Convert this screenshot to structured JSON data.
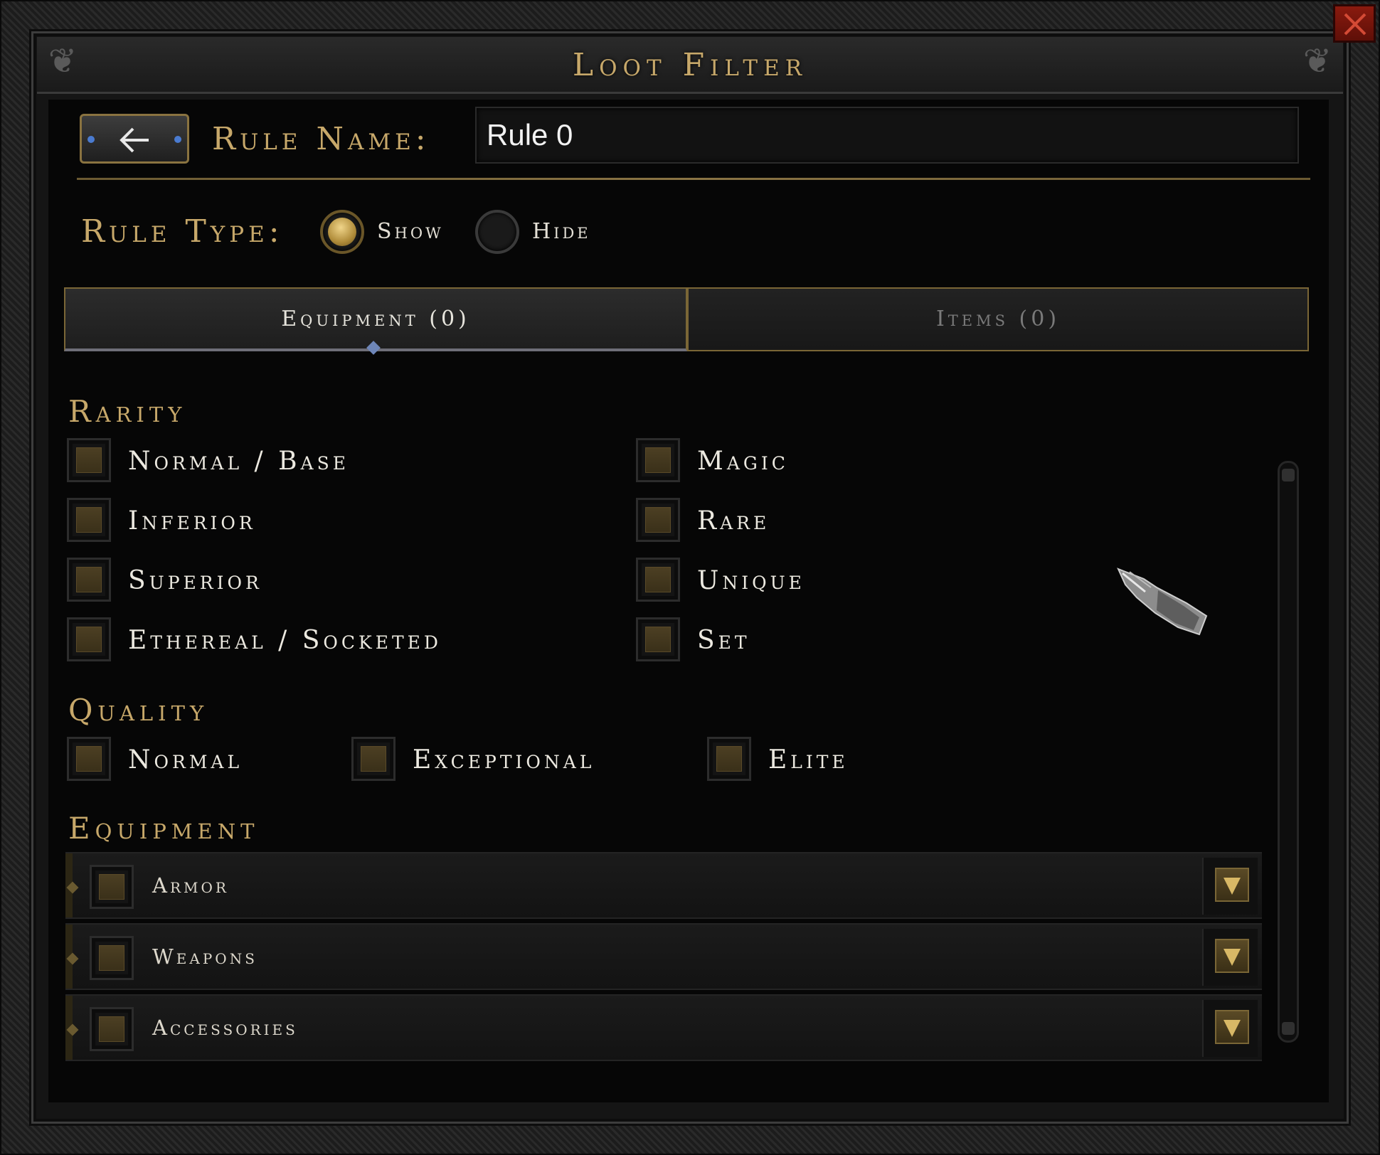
{
  "window": {
    "title": "Loot Filter",
    "close_icon": "close-x-icon"
  },
  "rule_name": {
    "back_icon": "arrow-left-icon",
    "label": "Rule Name:",
    "value": "Rule 0"
  },
  "rule_type": {
    "label": "Rule Type:",
    "options": [
      {
        "label": "Show",
        "selected": true
      },
      {
        "label": "Hide",
        "selected": false
      }
    ]
  },
  "tabs": [
    {
      "label": "Equipment (0)",
      "active": true
    },
    {
      "label": "Items (0)",
      "active": false
    }
  ],
  "rarity": {
    "heading": "Rarity",
    "options": [
      {
        "label": "Normal / Base",
        "checked": false
      },
      {
        "label": "Inferior",
        "checked": false
      },
      {
        "label": "Superior",
        "checked": false
      },
      {
        "label": "Ethereal / Socketed",
        "checked": false
      },
      {
        "label": "Magic",
        "checked": false
      },
      {
        "label": "Rare",
        "checked": false
      },
      {
        "label": "Unique",
        "checked": false
      },
      {
        "label": "Set",
        "checked": false
      }
    ]
  },
  "quality": {
    "heading": "Quality",
    "options": [
      {
        "label": "Normal",
        "checked": false
      },
      {
        "label": "Exceptional",
        "checked": false
      },
      {
        "label": "Elite",
        "checked": false
      }
    ]
  },
  "equipment": {
    "heading": "Equipment",
    "rows": [
      {
        "label": "Armor",
        "checked": false
      },
      {
        "label": "Weapons",
        "checked": false
      },
      {
        "label": "Accessories",
        "checked": false
      }
    ]
  },
  "colors": {
    "gold_text": "#c7a86a",
    "body_text": "#ece9e0",
    "close_red": "#8a1a0e"
  }
}
